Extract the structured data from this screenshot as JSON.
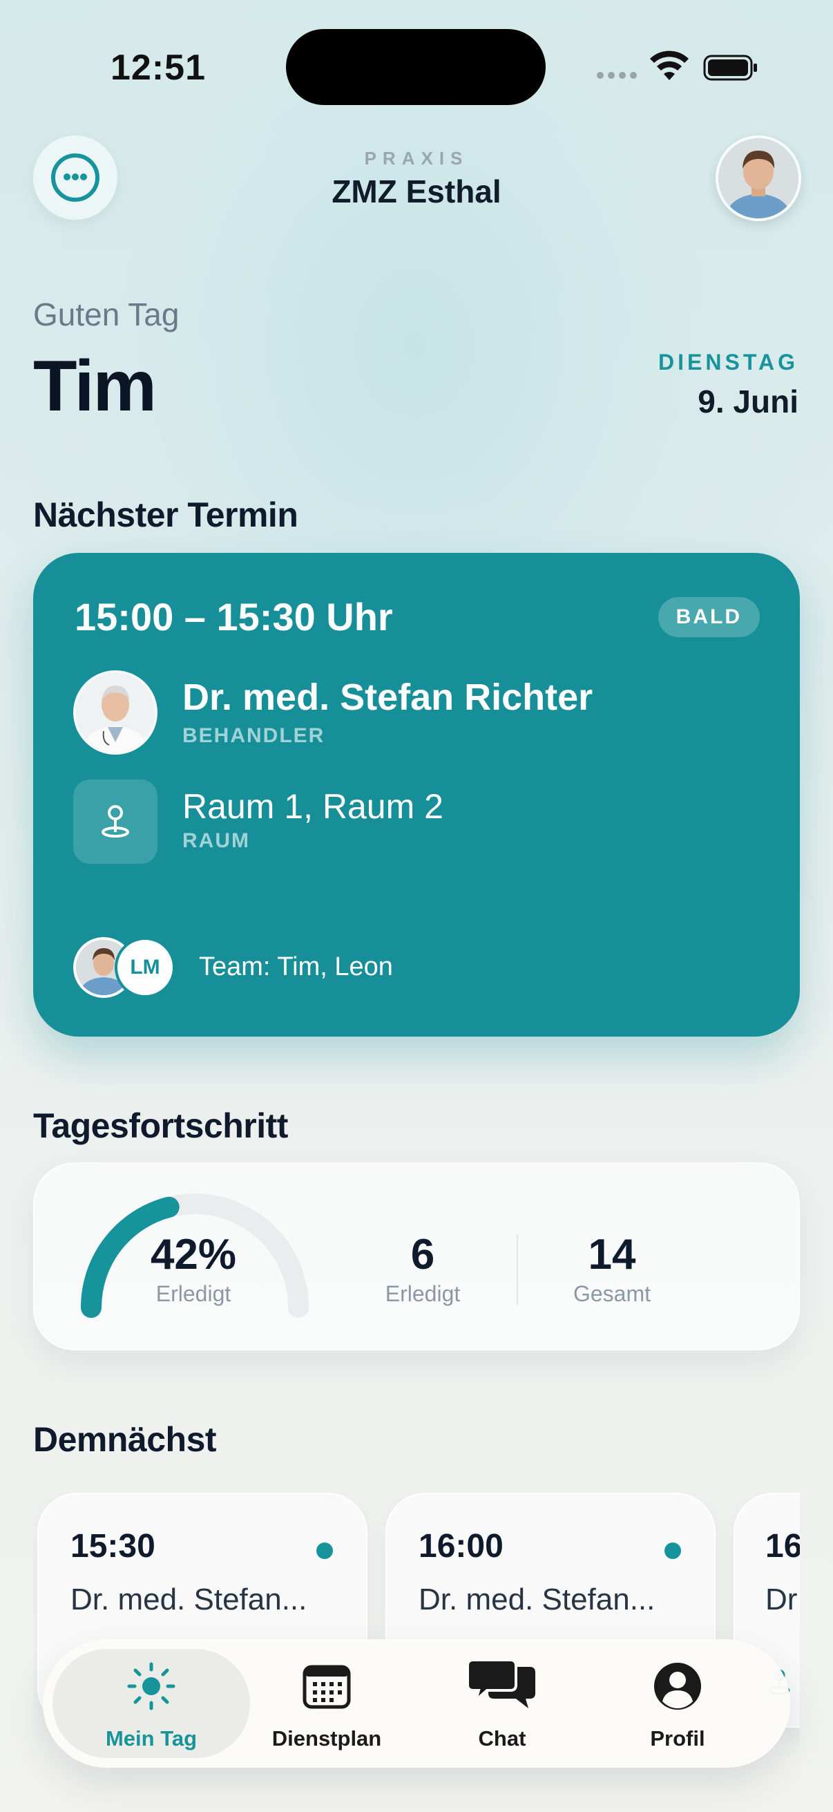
{
  "status_bar": {
    "time": "12:51"
  },
  "header": {
    "praxis_label": "PRAXIS",
    "praxis_name": "ZMZ Esthal"
  },
  "greeting": {
    "hello": "Guten Tag",
    "name": "Tim",
    "weekday": "DIENSTAG",
    "date": "9. Juni"
  },
  "next_appointment": {
    "section_title": "Nächster Termin",
    "time": "15:00 – 15:30 Uhr",
    "badge": "BALD",
    "doctor_name": "Dr. med. Stefan Richter",
    "doctor_role": "BEHANDLER",
    "room": "Raum 1, Raum 2",
    "room_label": "RAUM",
    "team_initials": "LM",
    "team_text": "Team: Tim, Leon",
    "card_color": "#168f98"
  },
  "progress": {
    "section_title": "Tagesfortschritt",
    "percent": 42,
    "percent_text": "42%",
    "percent_label": "Erledigt",
    "done_value": "6",
    "done_label": "Erledigt",
    "total_value": "14",
    "total_label": "Gesamt"
  },
  "upcoming": {
    "section_title": "Demnächst",
    "items": [
      {
        "time": "15:30",
        "doctor": "Dr. med. Stefan..."
      },
      {
        "time": "16:00",
        "doctor": "Dr. med. Stefan..."
      },
      {
        "time": "16",
        "doctor": "Dr"
      }
    ]
  },
  "tabbar": {
    "tabs": [
      {
        "label": "Mein Tag",
        "icon": "sun-icon",
        "active": true
      },
      {
        "label": "Dienstplan",
        "icon": "calendar-icon",
        "active": false
      },
      {
        "label": "Chat",
        "icon": "chat-icon",
        "active": false
      },
      {
        "label": "Profil",
        "icon": "profile-icon",
        "active": false
      }
    ]
  },
  "colors": {
    "accent": "#17939b",
    "text": "#0f1b2d"
  }
}
